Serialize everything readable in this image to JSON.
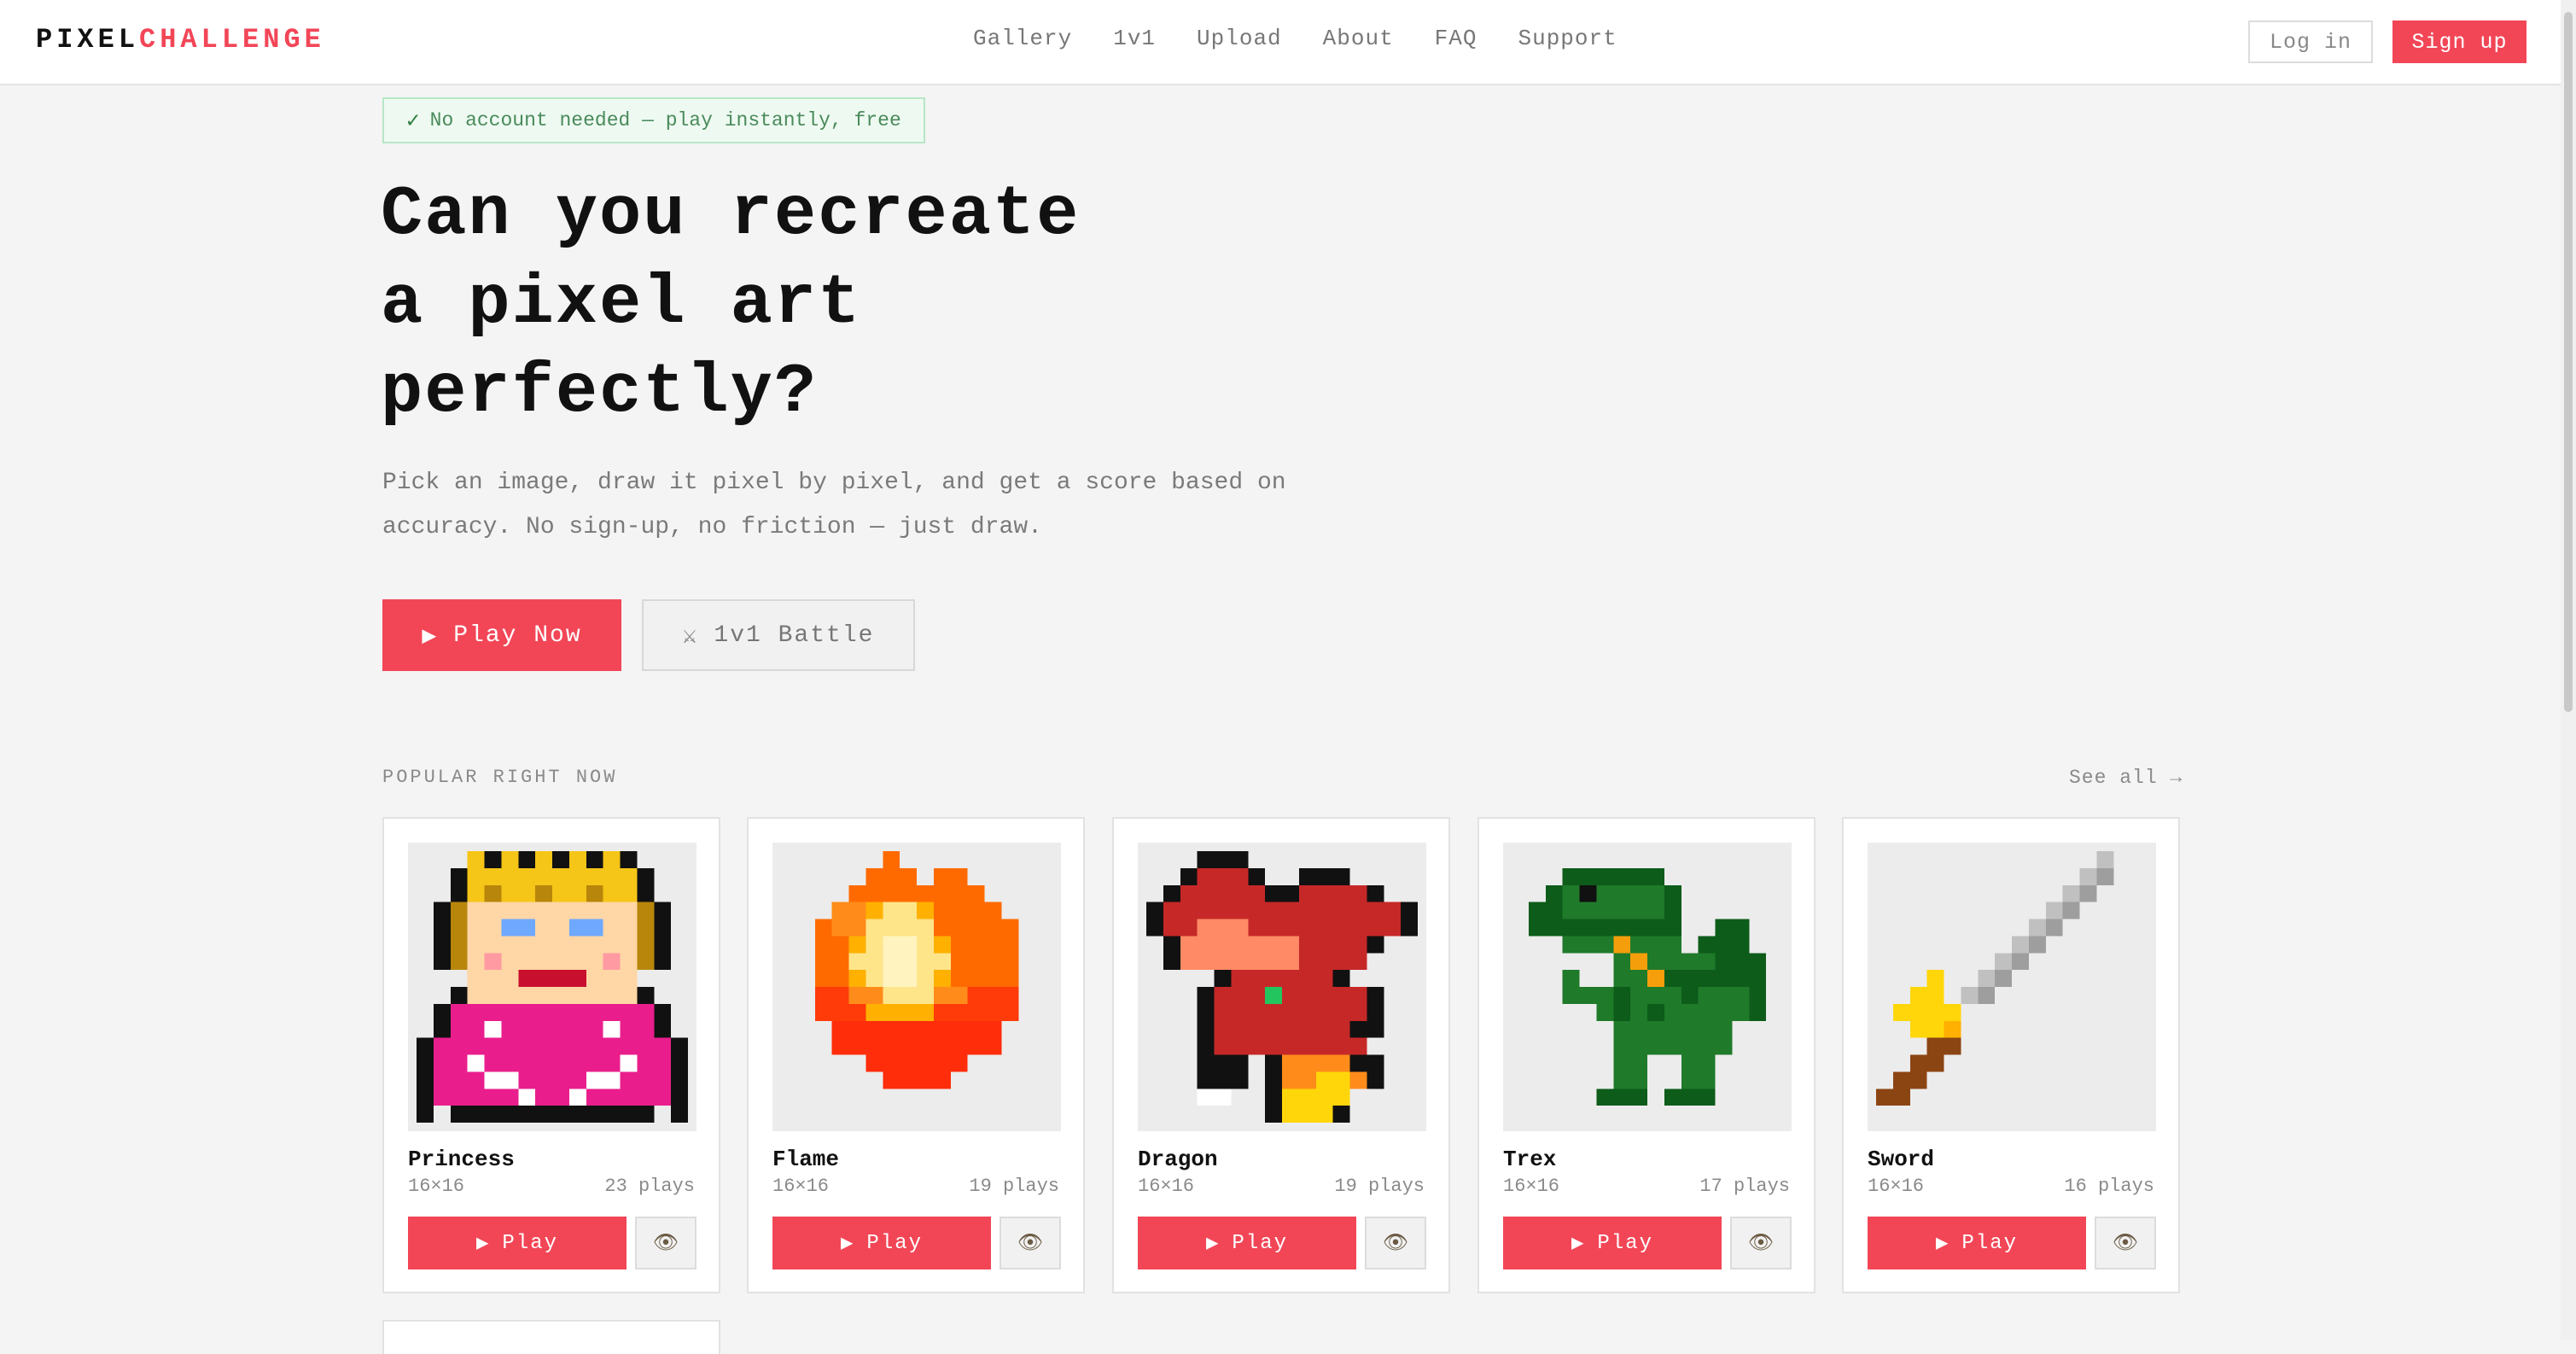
{
  "nav": {
    "logo_part1": "PIXEL",
    "logo_part2": "CHALLENGE",
    "links": [
      "Gallery",
      "1v1",
      "Upload",
      "About",
      "FAQ",
      "Support"
    ],
    "login": "Log in",
    "signup": "Sign up"
  },
  "hero": {
    "badge_icon": "✓",
    "badge": "No account needed — play instantly, free",
    "title_lines": [
      "Can you recreate",
      "a pixel art",
      "perfectly?"
    ],
    "subtitle_lines": [
      "Pick an image, draw it pixel by pixel, and get a score based on",
      "accuracy. No sign-up, no friction — just draw."
    ],
    "play_icon": "▶",
    "play_now": "Play Now",
    "battle_icon": "⚔",
    "battle": "1v1 Battle"
  },
  "popular": {
    "label": "POPULAR RIGHT NOW",
    "see_all": "See all →",
    "play_icon": "▶",
    "play_label": "Play",
    "view_icon": "👁",
    "items": [
      {
        "name": "Princess",
        "size": "16×16",
        "plays": "23 plays"
      },
      {
        "name": "Flame",
        "size": "16×16",
        "plays": "19 plays"
      },
      {
        "name": "Dragon",
        "size": "16×16",
        "plays": "19 plays"
      },
      {
        "name": "Trex",
        "size": "16×16",
        "plays": "17 plays"
      },
      {
        "name": "Sword",
        "size": "16×16",
        "plays": "16 plays"
      }
    ]
  },
  "colors": {
    "accent": "#f24657",
    "badge_bg": "#eefaf1",
    "badge_border": "#b7e6c6"
  }
}
